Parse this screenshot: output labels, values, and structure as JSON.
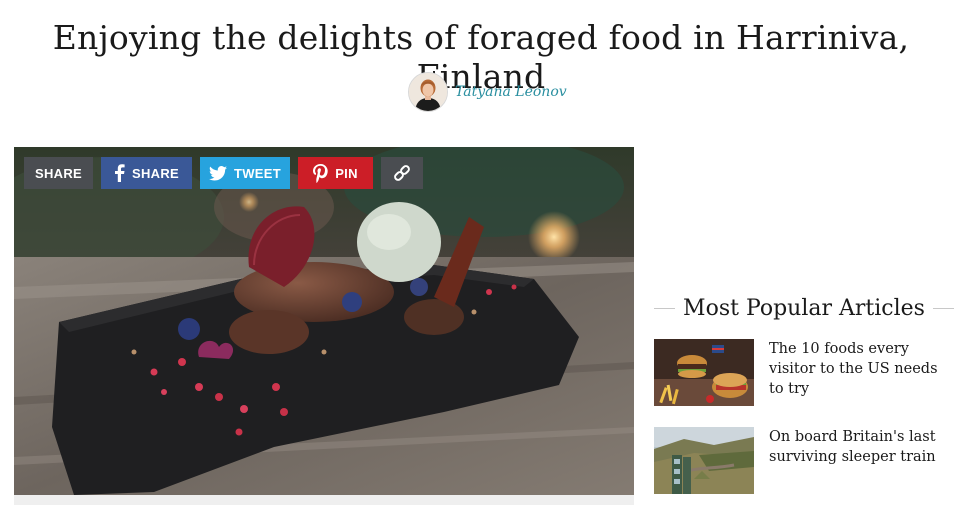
{
  "article": {
    "title": "Enjoying the delights of foraged food in Harriniva, Finland",
    "author": "Tatyana Leonov"
  },
  "share": {
    "generic_label": "SHARE",
    "facebook_label": "SHARE",
    "twitter_label": "TWEET",
    "pinterest_label": "PIN",
    "link_icon": "link-icon"
  },
  "most_popular": {
    "heading": "Most Popular Articles",
    "items": [
      {
        "title": "The 10 foods every visitor to the US needs to try"
      },
      {
        "title": "On board Britain's last surviving sleeper train"
      }
    ]
  },
  "colors": {
    "author_link": "#2a8fa0",
    "share_generic": "#4a4d51",
    "facebook": "#3a5897",
    "twitter": "#27a3de",
    "pinterest": "#cc1e27"
  }
}
